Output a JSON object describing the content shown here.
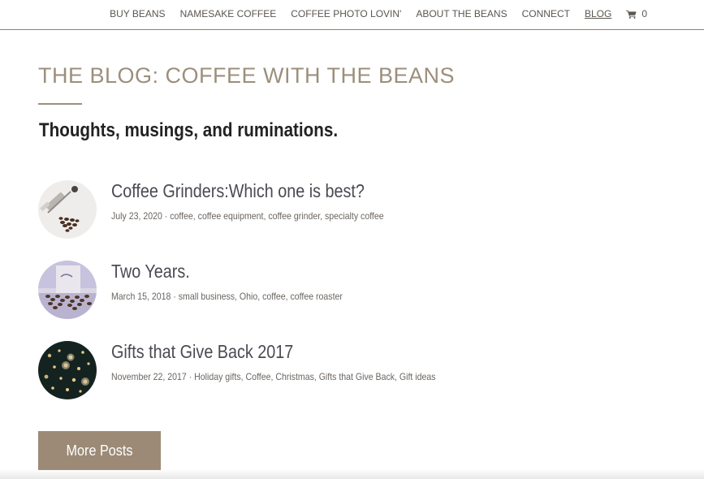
{
  "nav": {
    "items": [
      {
        "label": "BUY BEANS",
        "active": false
      },
      {
        "label": "NAMESAKE COFFEE",
        "active": false
      },
      {
        "label": "COFFEE PHOTO LOVIN'",
        "active": false
      },
      {
        "label": "ABOUT THE BEANS",
        "active": false
      },
      {
        "label": "CONNECT",
        "active": false
      },
      {
        "label": "BLOG",
        "active": true
      }
    ],
    "cart_icon": "shopping-cart-icon",
    "cart_count": "0"
  },
  "page": {
    "title": "THE BLOG: COFFEE WITH THE BEANS",
    "subtitle": "Thoughts, musings, and ruminations.",
    "accent_color": "#9c8f7c"
  },
  "posts": [
    {
      "title": "Coffee Grinders:Which one is best?",
      "date": "July 23, 2020",
      "tags": "coffee, coffee equipment, coffee grinder, specialty coffee",
      "thumb": "coffee-grinder-photo"
    },
    {
      "title": "Two Years.",
      "date": "March 15, 2018",
      "tags": "small business, Ohio, coffee, coffee roaster",
      "thumb": "coffee-bag-photo"
    },
    {
      "title": "Gifts that Give Back 2017",
      "date": "November 22, 2017",
      "tags": "Holiday gifts, Coffee, Christmas, Gifts that Give Back, Gift ideas",
      "thumb": "holiday-lights-photo"
    }
  ],
  "more_button": {
    "label": "More Posts",
    "color": "#9c8a76"
  },
  "separator": " · "
}
